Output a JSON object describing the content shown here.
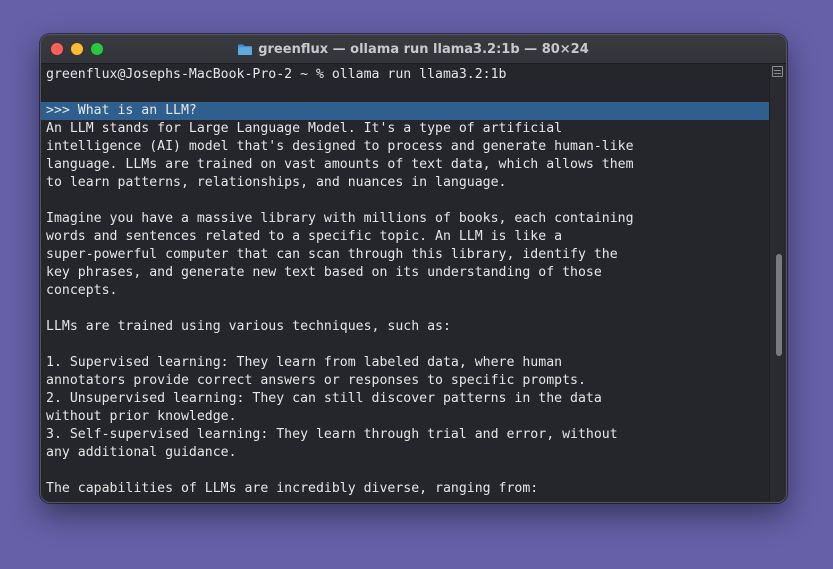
{
  "window": {
    "title": "greenflux — ollama run llama3.2:1b — 80×24",
    "icons": {
      "folder": "folder-icon",
      "scroll": "scroll-menu-icon"
    }
  },
  "terminal": {
    "lines": [
      "greenflux@Josephs-MacBook-Pro-2 ~ % ollama run llama3.2:1b",
      "",
      ">>> What is an LLM?",
      "An LLM stands for Large Language Model. It's a type of artificial",
      "intelligence (AI) model that's designed to process and generate human-like",
      "language. LLMs are trained on vast amounts of text data, which allows them",
      "to learn patterns, relationships, and nuances in language.",
      "",
      "Imagine you have a massive library with millions of books, each containing",
      "words and sentences related to a specific topic. An LLM is like a",
      "super-powerful computer that can scan through this library, identify the",
      "key phrases, and generate new text based on its understanding of those",
      "concepts.",
      "",
      "LLMs are trained using various techniques, such as:",
      "",
      "1. Supervised learning: They learn from labeled data, where human",
      "annotators provide correct answers or responses to specific prompts.",
      "2. Unsupervised learning: They can still discover patterns in the data",
      "without prior knowledge.",
      "3. Self-supervised learning: They learn through trial and error, without",
      "any additional guidance.",
      "",
      "The capabilities of LLMs are incredibly diverse, ranging from:"
    ],
    "highlight_bracket": "]"
  },
  "colors": {
    "desktop": "#6560a8",
    "terminal_bg": "#25262b",
    "text": "#e6e6e6",
    "highlight": "#2f5f8f",
    "close": "#fe5f57",
    "minimize": "#febc2e",
    "maximize": "#28c840"
  }
}
